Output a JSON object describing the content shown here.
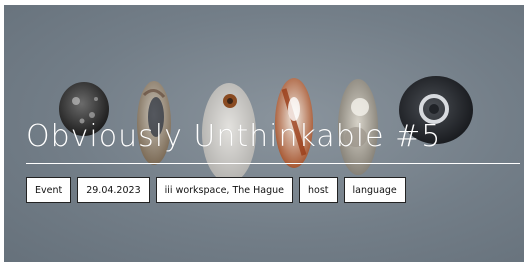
{
  "event": {
    "title": "Obviously Unthinkable #5",
    "tags": [
      {
        "label": "Event"
      },
      {
        "label": "29.04.2023"
      },
      {
        "label": "iii workspace, The Hague"
      },
      {
        "label": "host"
      },
      {
        "label": "language"
      }
    ]
  },
  "colors": {
    "background": "#737e88",
    "title": "#ffffff",
    "tag_background": "#ffffff",
    "tag_border": "#222222"
  }
}
